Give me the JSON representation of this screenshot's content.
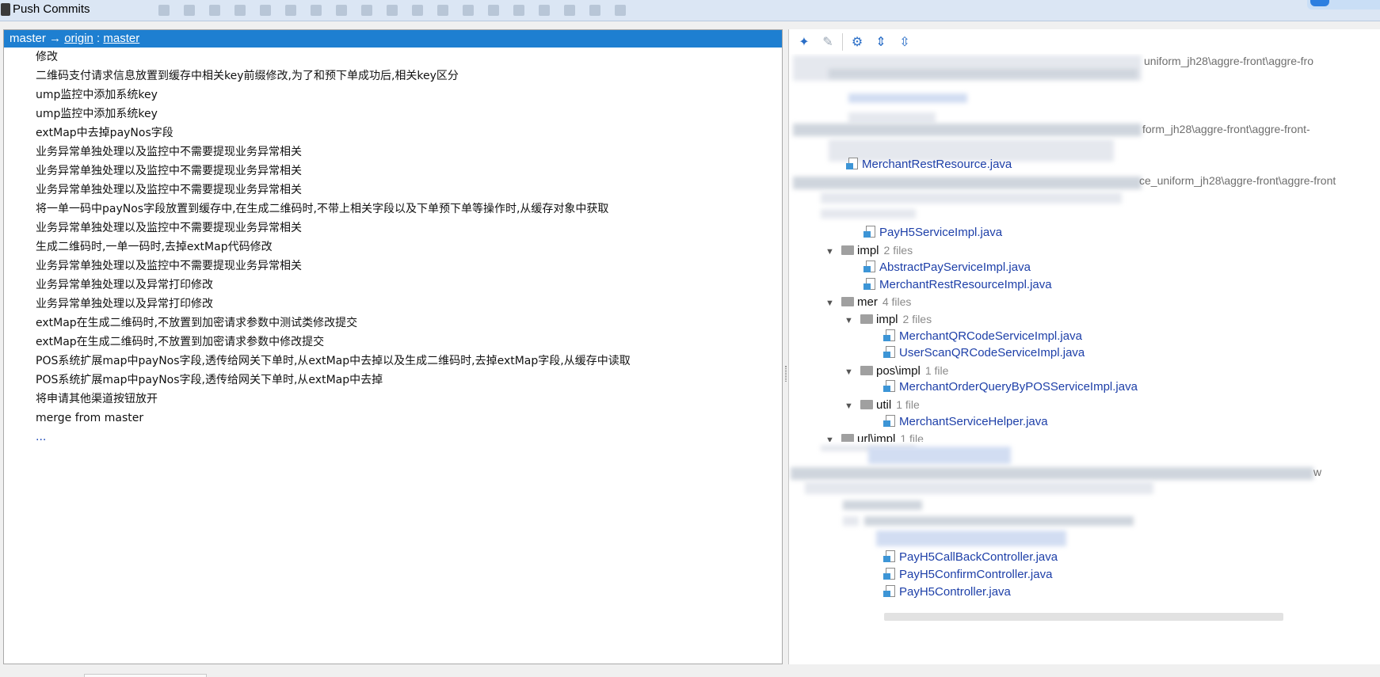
{
  "window": {
    "title": "Push Commits"
  },
  "branch": {
    "local": "master",
    "arrow": "→",
    "remote": "origin",
    "separator": ":",
    "remote_branch": "master"
  },
  "commits": [
    "修改",
    "二维码支付请求信息放置到缓存中相关key前缀修改,为了和预下单成功后,相关key区分",
    "ump监控中添加系统key",
    "ump监控中添加系统key",
    "extMap中去掉payNos字段",
    "业务异常单独处理以及监控中不需要提现业务异常相关",
    "业务异常单独处理以及监控中不需要提现业务异常相关",
    "业务异常单独处理以及监控中不需要提现业务异常相关",
    "将一单一码中payNos字段放置到缓存中,在生成二维码时,不带上相关字段以及下单预下单等操作时,从缓存对象中获取",
    "业务异常单独处理以及监控中不需要提现业务异常相关",
    "生成二维码时,一单一码时,去掉extMap代码修改",
    "业务异常单独处理以及监控中不需要提现业务异常相关",
    "业务异常单独处理以及异常打印修改",
    "业务异常单独处理以及异常打印修改",
    "extMap在生成二维码时,不放置到加密请求参数中测试类修改提交",
    "extMap在生成二维码时,不放置到加密请求参数中修改提交",
    "POS系统扩展map中payNos字段,透传给网关下单时,从extMap中去掉以及生成二维码时,去掉extMap字段,从缓存中读取",
    "POS系统扩展map中payNos字段,透传给网关下单时,从extMap中去掉",
    "将申请其他渠道按钮放开",
    "merge from master"
  ],
  "more_label": "...",
  "toolbar": {
    "icons": [
      "pin-icon",
      "edit-source-icon",
      "gear-icon",
      "expand-all-icon",
      "collapse-all-icon"
    ]
  },
  "tree": {
    "path_tails": [
      "uniform_jh28\\aggre-front\\aggre-fro",
      "form_jh28\\aggre-front\\aggre-front-",
      "ce_uniform_jh28\\aggre-front\\aggre-front",
      "w"
    ],
    "files_top": [
      "MerchantRestResource.java",
      "PayH5ServiceImpl.java"
    ],
    "impl": {
      "name": "impl",
      "count": "2 files",
      "files": [
        "AbstractPayServiceImpl.java",
        "MerchantRestResourceImpl.java"
      ]
    },
    "mer": {
      "name": "mer",
      "count": "4 files"
    },
    "mer_impl": {
      "name": "impl",
      "count": "2 files",
      "files": [
        "MerchantQRCodeServiceImpl.java",
        "UserScanQRCodeServiceImpl.java"
      ]
    },
    "pos_impl": {
      "name": "pos\\impl",
      "count": "1 file",
      "files": [
        "MerchantOrderQueryByPOSServiceImpl.java"
      ]
    },
    "util": {
      "name": "util",
      "count": "1 file",
      "files": [
        "MerchantServiceHelper.java"
      ]
    },
    "url_impl": {
      "name": "url\\impl",
      "count": "1 file"
    },
    "controllers": [
      "PayH5CallBackController.java",
      "PayH5ConfirmController.java",
      "PayH5Controller.java"
    ]
  }
}
